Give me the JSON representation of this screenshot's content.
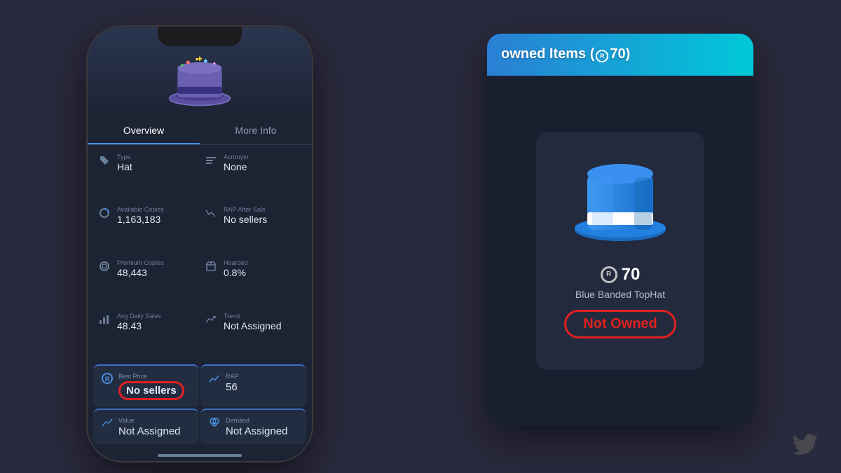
{
  "phone": {
    "tabs": {
      "overview": "Overview",
      "more_info": "More Info"
    },
    "stats": [
      {
        "label": "Type",
        "value": "Hat",
        "icon": "tag"
      },
      {
        "label": "Acronym",
        "value": "None",
        "icon": "label"
      },
      {
        "label": "Available Copies",
        "value": "1,163,183",
        "icon": "circle-chart"
      },
      {
        "label": "RAP After Sale",
        "value": "No sellers",
        "icon": "trend-down"
      },
      {
        "label": "Premium Copies",
        "value": "48,443",
        "icon": "premium-circle"
      },
      {
        "label": "Hoarded",
        "value": "0.8%",
        "icon": "box"
      },
      {
        "label": "Avg Daily Sales",
        "value": "48.43",
        "icon": "bar-chart"
      },
      {
        "label": "Trend",
        "value": "Not Assigned",
        "icon": "trend-x"
      }
    ],
    "cards": [
      {
        "label": "Best Price",
        "value": "No sellers",
        "icon": "robux",
        "highlighted": true
      },
      {
        "label": "RAP",
        "value": "56",
        "icon": "chart"
      },
      {
        "label": "Value",
        "value": "Not Assigned",
        "icon": "line-chart"
      },
      {
        "label": "Demand",
        "value": "Not Assigned",
        "icon": "heart-chart"
      }
    ]
  },
  "right_panel": {
    "header_text": "owned Items (",
    "robux_amount": "70",
    "header_suffix": ")",
    "item": {
      "price": "70",
      "name": "Blue Banded TopHat",
      "status": "Not Owned"
    }
  },
  "icons": {
    "tag": "🏷",
    "circle": "◉",
    "bar": "▦",
    "trend": "↗",
    "box": "📦",
    "robux": "⊙",
    "heart": "♥"
  }
}
